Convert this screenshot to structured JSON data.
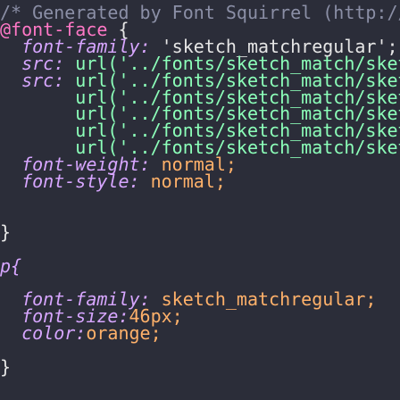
{
  "editor": {
    "lines": [
      {
        "tokens": [
          {
            "cls": "comment",
            "text": "/* Generated by Font Squirrel (http://ww"
          }
        ]
      },
      {
        "tokens": [
          {
            "cls": "at",
            "text": "@font-face"
          },
          {
            "cls": "punct",
            "text": " {"
          }
        ]
      },
      {
        "tokens": [
          {
            "cls": "prop",
            "text": "  font-family:"
          },
          {
            "cls": "str",
            "text": " 'sketch_matchregular';"
          }
        ]
      },
      {
        "tokens": [
          {
            "cls": "prop",
            "text": "  src:"
          },
          {
            "cls": "punct",
            "text": " "
          },
          {
            "cls": "url",
            "text": "url('../fonts/sketch_match/sket"
          }
        ]
      },
      {
        "tokens": [
          {
            "cls": "prop",
            "text": "  src:"
          },
          {
            "cls": "punct",
            "text": " "
          },
          {
            "cls": "url",
            "text": "url('../fonts/sketch_match/sket"
          }
        ]
      },
      {
        "tokens": [
          {
            "cls": "punct",
            "text": "       "
          },
          {
            "cls": "url",
            "text": "url('../fonts/sketch_match/sket"
          }
        ]
      },
      {
        "tokens": [
          {
            "cls": "punct",
            "text": "       "
          },
          {
            "cls": "url",
            "text": "url('../fonts/sketch_match/sket"
          }
        ]
      },
      {
        "tokens": [
          {
            "cls": "punct",
            "text": "       "
          },
          {
            "cls": "url",
            "text": "url('../fonts/sketch_match/sket"
          }
        ]
      },
      {
        "tokens": [
          {
            "cls": "punct",
            "text": "       "
          },
          {
            "cls": "url",
            "text": "url('../fonts/sketch_match/sket"
          }
        ]
      },
      {
        "tokens": [
          {
            "cls": "prop",
            "text": "  font-weight:"
          },
          {
            "cls": "val",
            "text": " normal;"
          }
        ]
      },
      {
        "tokens": [
          {
            "cls": "prop",
            "text": "  font-style:"
          },
          {
            "cls": "val",
            "text": " normal;"
          }
        ]
      },
      {
        "tokens": []
      },
      {
        "tokens": []
      },
      {
        "tokens": [
          {
            "cls": "punct",
            "text": "}"
          }
        ]
      },
      {
        "tokens": []
      },
      {
        "tokens": [
          {
            "cls": "selector",
            "text": "p{"
          }
        ]
      },
      {
        "tokens": []
      },
      {
        "tokens": [
          {
            "cls": "prop",
            "text": "  font-family:"
          },
          {
            "cls": "val",
            "text": " sketch_matchregular;"
          }
        ]
      },
      {
        "tokens": [
          {
            "cls": "prop",
            "text": "  font-size:"
          },
          {
            "cls": "val",
            "text": "46px;"
          }
        ]
      },
      {
        "tokens": [
          {
            "cls": "prop",
            "text": "  color:"
          },
          {
            "cls": "val",
            "text": "orange;"
          }
        ]
      },
      {
        "tokens": []
      },
      {
        "tokens": [
          {
            "cls": "punct",
            "text": "}"
          }
        ]
      }
    ]
  },
  "colors": {
    "background": "#2b2d39",
    "comment": "#8b8fa6",
    "at_rule": "#ff78c6",
    "property": "#d7a6ff",
    "url": "#8cffb9",
    "value": "#ffb16a"
  }
}
